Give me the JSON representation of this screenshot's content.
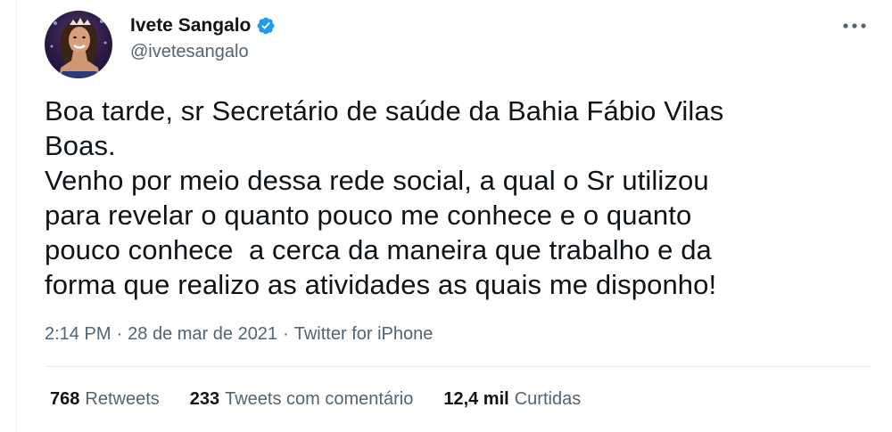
{
  "author": {
    "display_name": "Ivete Sangalo",
    "handle": "@ivetesangalo",
    "verified": true,
    "verified_color": "#1d9bf0"
  },
  "menu": {
    "icon": "more-horizontal-icon"
  },
  "tweet": {
    "text": "Boa tarde, sr Secretário de saúde da Bahia Fábio Vilas\nBoas.\nVenho por meio dessa rede social, a qual o Sr utilizou\npara revelar o quanto pouco me conhece e o quanto\npouco conhece  a cerca da maneira que trabalho e da\nforma que realizo as atividades as quais me disponho!"
  },
  "meta": {
    "time": "2:14 PM",
    "separator": "·",
    "date": "28 de mar de 2021",
    "source": "Twitter for iPhone"
  },
  "stats": {
    "retweets": {
      "count": "768",
      "label": "Retweets"
    },
    "quotes": {
      "count": "233",
      "label": "Tweets com comentário"
    },
    "likes": {
      "count": "12,4 mil",
      "label": "Curtidas"
    }
  },
  "colors": {
    "text": "#0f1419",
    "secondary": "#536471",
    "divider": "#e7ecee"
  }
}
